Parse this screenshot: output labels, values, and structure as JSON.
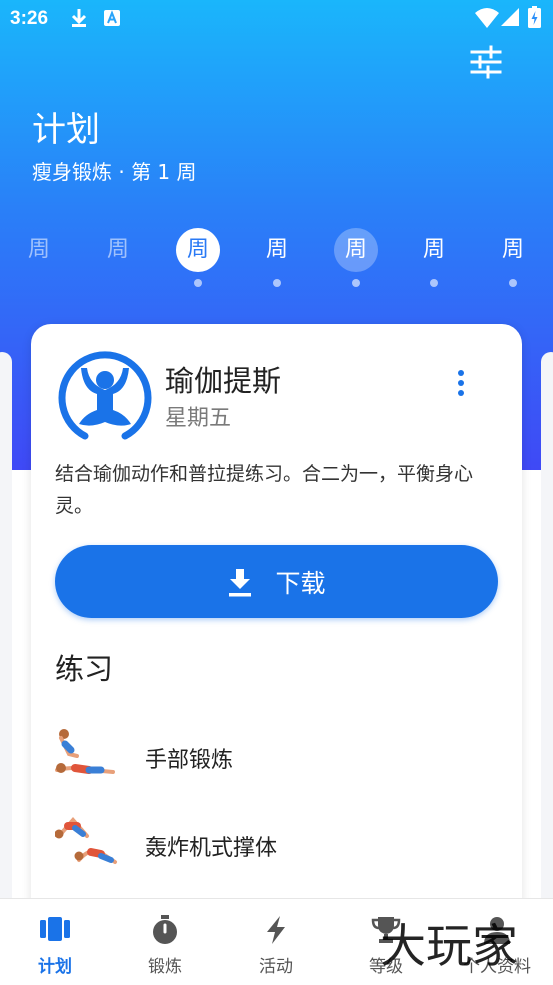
{
  "status_bar": {
    "time": "3:26",
    "left_icons": [
      "download-icon",
      "a-notification-icon"
    ],
    "right_icons": [
      "wifi-icon",
      "signal-icon",
      "battery-charging-icon"
    ]
  },
  "header": {
    "title": "计划",
    "subtitle": "瘦身锻炼 · 第 1 周",
    "filter_icon": "sliders-icon",
    "gradient_colors": [
      "#1ab6fb",
      "#3f49f6"
    ]
  },
  "weeks": [
    {
      "label": "周",
      "state": "past"
    },
    {
      "label": "周",
      "state": "past"
    },
    {
      "label": "周",
      "state": "selected"
    },
    {
      "label": "周",
      "state": "normal"
    },
    {
      "label": "周",
      "state": "current"
    },
    {
      "label": "周",
      "state": "normal"
    },
    {
      "label": "周",
      "state": "normal"
    }
  ],
  "workout": {
    "name": "瑜伽提斯",
    "day": "星期五",
    "description": "结合瑜伽动作和普拉提练习。合二为一，平衡身心灵。",
    "icon": "yoga-meditation-icon",
    "download_label": "下载",
    "download_icon": "download-icon",
    "more_icon": "more-vertical-icon",
    "accent_color": "#1a73e8"
  },
  "exercises_section": {
    "title": "练习",
    "items": [
      {
        "name": "手部锻炼",
        "thumb": "hand-exercise-thumb"
      },
      {
        "name": "轰炸机式撑体",
        "thumb": "bomber-pushup-thumb"
      }
    ]
  },
  "bottom_nav": [
    {
      "label": "计划",
      "icon": "plan-icon",
      "active": true
    },
    {
      "label": "锻炼",
      "icon": "stopwatch-icon",
      "active": false
    },
    {
      "label": "活动",
      "icon": "lightning-icon",
      "active": false
    },
    {
      "label": "等级",
      "icon": "trophy-icon",
      "active": false
    },
    {
      "label": "个人资料",
      "icon": "profile-icon",
      "active": false
    }
  ],
  "watermark": "大玩家"
}
